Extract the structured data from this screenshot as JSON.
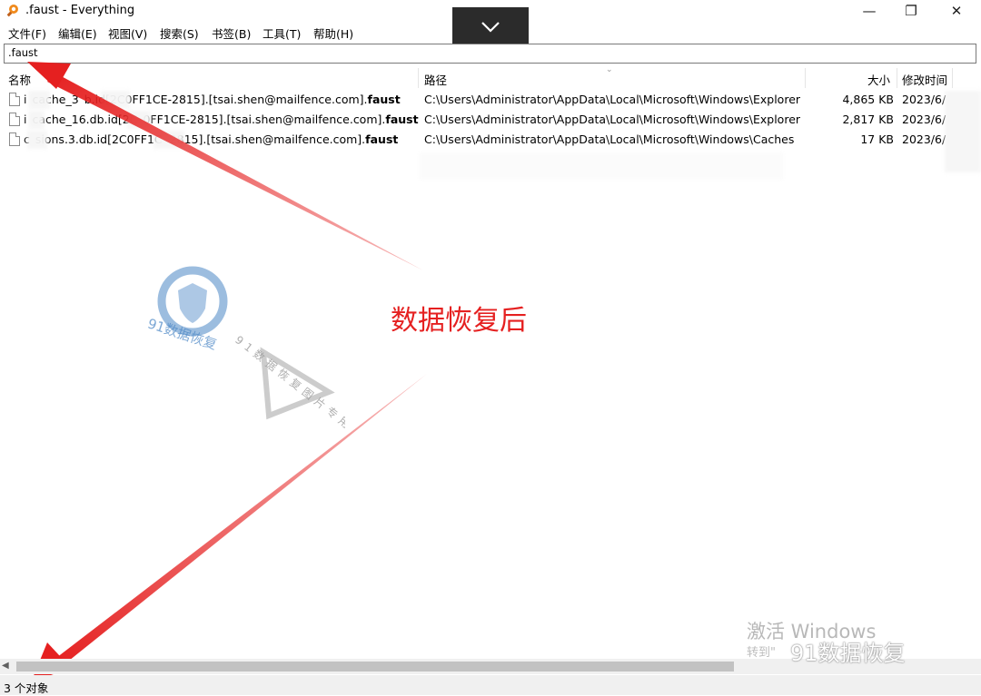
{
  "window": {
    "title": ".faust  - Everything",
    "minimize": "—",
    "restore": "❐",
    "close": "✕"
  },
  "menu": [
    {
      "label": "文件(F)"
    },
    {
      "label": "编辑(E)"
    },
    {
      "label": "视图(V)"
    },
    {
      "label": "搜索(S)"
    },
    {
      "label": "书签(B)"
    },
    {
      "label": "工具(T)"
    },
    {
      "label": "帮助(H)"
    }
  ],
  "search": {
    "value": ".faust"
  },
  "columns": {
    "name": "名称",
    "path": "路径",
    "size": "大小",
    "modified": "修改时间"
  },
  "rows": [
    {
      "name_prefix": "i",
      "name_middle": "cache_3",
      "name_rest": "b.id[2C",
      "name_tail": "0FF1CE-2815].[tsai.shen@mailfence.com].",
      "ext": "faust",
      "path": "C:\\Users\\Administrator\\AppData\\Local\\Microsoft\\Windows\\Explorer",
      "size": "4,865 KB",
      "date": "2023/6/"
    },
    {
      "name_prefix": "i",
      "name_middle": "cache_16.db.id[2C",
      "name_rest": "",
      "name_tail": "0FF1CE-2815].[tsai.shen@mailfence.com].",
      "ext": "faust",
      "path": "C:\\Users\\Administrator\\AppData\\Local\\Microsoft\\Windows\\Explorer",
      "size": "2,817 KB",
      "date": "2023/6/"
    },
    {
      "name_prefix": "c",
      "name_middle": "sions.3.db.id[2C0FF1C",
      "name_rest": "",
      "name_tail": "2815].[tsai.shen@mailfence.com].",
      "ext": "faust",
      "path": "C:\\Users\\Administrator\\AppData\\Local\\Microsoft\\Windows\\Caches",
      "size": "17 KB",
      "date": "2023/6/"
    }
  ],
  "status": {
    "text": "3 个对象"
  },
  "annotation": {
    "text": "数据恢复后"
  },
  "watermarks": {
    "activate_windows": "激活 Windows",
    "activate_sub": "转到\"",
    "brand": "91数据恢复",
    "logo_text": "91数据恢复",
    "diagonal_text": "91数据恢复图片专用水印"
  },
  "colors": {
    "arrow": "#e52020",
    "annotation": "#e52020",
    "logo_blue": "#4a86c5"
  }
}
